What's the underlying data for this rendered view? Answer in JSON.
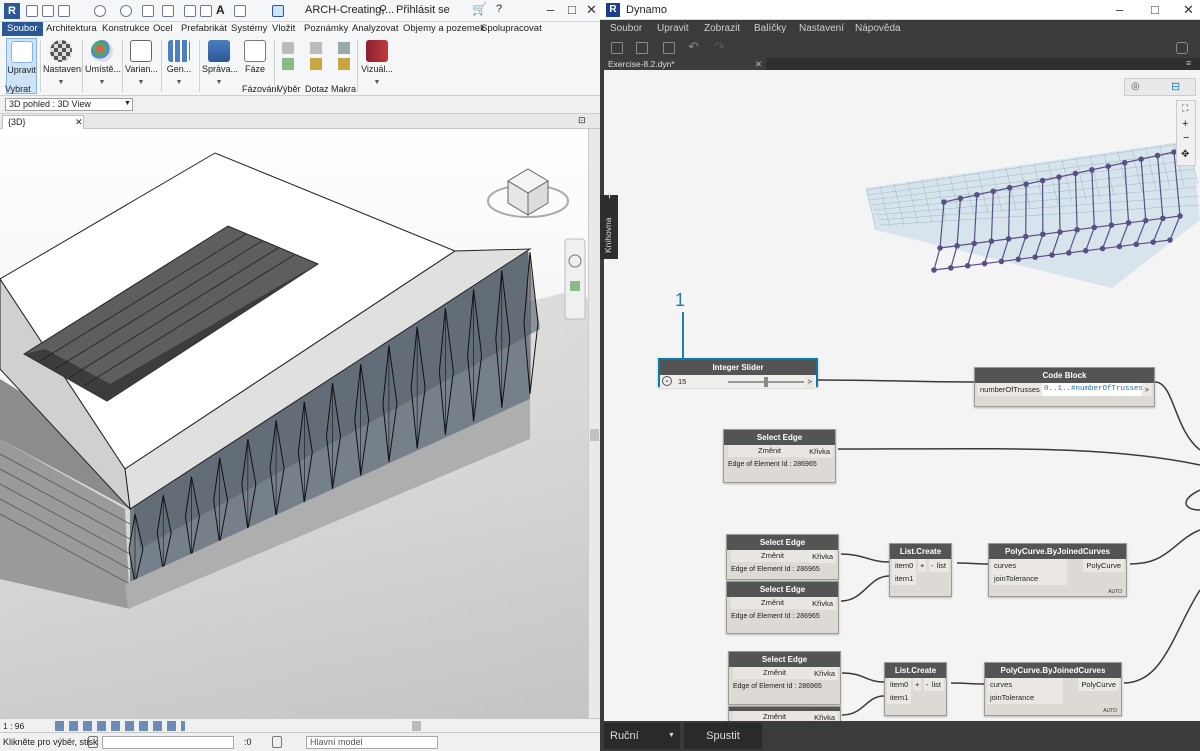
{
  "revit": {
    "window_title": "ARCH-Creating-...",
    "login_label": "Přihlásit se",
    "menu_tabs": [
      "Soubor",
      "Architektura",
      "Konstrukce",
      "Ocel",
      "Prefabrikát",
      "Systémy",
      "Vložit",
      "Poznámky",
      "Analyzovat",
      "Objemy a pozemek",
      "Spolupracovat"
    ],
    "ribbon": {
      "buttons": [
        {
          "label": "Upravit",
          "icon": "cursor-icon"
        },
        {
          "label": "Nastavení",
          "icon": "material-sphere-icon"
        },
        {
          "label": "Umístě...",
          "icon": "palette-icon"
        },
        {
          "label": "Varian...",
          "icon": "list-window-icon"
        },
        {
          "label": "Gen...",
          "icon": "grid-generate-icon"
        },
        {
          "label": "Správa...",
          "icon": "manage-icon"
        },
        {
          "label": "Fáze",
          "icon": "phase-icon"
        },
        {
          "label": "Vizuál...",
          "icon": "book-icon"
        }
      ],
      "small_labels": [
        "Fázování",
        "Výběr",
        "Dotaz",
        "Makra"
      ],
      "select_label": "Vybrat"
    },
    "type_selector": "3D pohled : 3D View",
    "view_tab": "{3D}",
    "scale": "1 : 96",
    "status_text": "Klikněte pro výběr, stisk",
    "status_value": ":0",
    "status_model": "Hlavní model"
  },
  "dynamo": {
    "title": "Dynamo",
    "menu": [
      "Soubor",
      "Upravit",
      "Zobrazit",
      "Balíčky",
      "Nastavení",
      "Nápověda"
    ],
    "file_tab": "Exercise-8.2.dyn*",
    "library_tab": "Knihovna",
    "run_mode": "Ruční",
    "run_button": "Spustit",
    "annotation": "1",
    "nodes": {
      "slider": {
        "title": "Integer Slider",
        "value": "15"
      },
      "code_block": {
        "title": "Code Block",
        "input": "numberOfTrusses",
        "code": "0..1..#numberOfTrusses;",
        "output": ">"
      },
      "edge1": {
        "title": "Select Edge",
        "button": "Změnit",
        "output": "Křivka",
        "info": "Edge of Element Id : 286965"
      },
      "edge2": {
        "title": "Select Edge",
        "button": "Změnit",
        "output": "Křivka",
        "info": "Edge of Element Id : 286965"
      },
      "edge3": {
        "title": "Select Edge",
        "button": "Změnit",
        "output": "Křivka",
        "info": "Edge of Element Id : 286965"
      },
      "edge4": {
        "title": "Select Edge",
        "button": "Změnit",
        "output": "Křivka",
        "info": "Edge of Element Id : 286965"
      },
      "edge5": {
        "title": "Select Edge",
        "button": "Změnit",
        "output": "Křivka"
      },
      "list1": {
        "title": "List.Create",
        "in0": "item0",
        "in1": "item1",
        "plus": "+",
        "minus": "-",
        "output": "list"
      },
      "list2": {
        "title": "List.Create",
        "in0": "item0",
        "in1": "item1",
        "plus": "+",
        "minus": "-",
        "output": "list"
      },
      "poly1": {
        "title": "PolyCurve.ByJoinedCurves",
        "in0": "curves",
        "in1": "joinTolerance",
        "output": "PolyCurve",
        "lacing": "AUTO"
      },
      "poly2": {
        "title": "PolyCurve.ByJoinedCurves",
        "in0": "curves",
        "in1": "joinTolerance",
        "output": "PolyCurve",
        "lacing": "AUTO"
      }
    }
  },
  "colors": {
    "revit_accent": "#2b5797",
    "dynamo_bg": "#3b3b3b",
    "canvas_bg": "#f4f4f4",
    "node_header": "#545454",
    "selection": "#0a7ba8",
    "truss_preview": "#5a4f86"
  }
}
